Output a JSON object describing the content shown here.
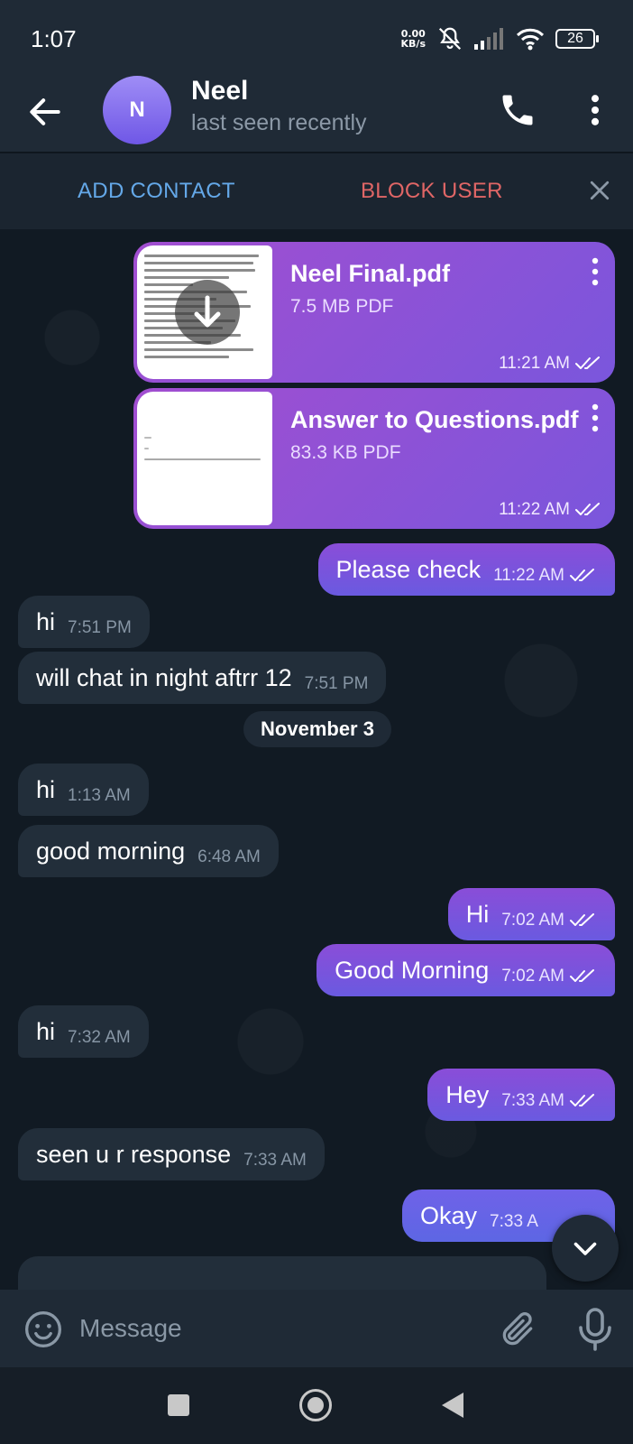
{
  "status_bar": {
    "time": "1:07",
    "net_speed_value": "0.00",
    "net_speed_unit": "KB/s",
    "battery": "26"
  },
  "header": {
    "avatar_letter": "N",
    "name": "Neel",
    "status": "last seen recently"
  },
  "action_bar": {
    "add_contact": "ADD CONTACT",
    "block_user": "BLOCK USER"
  },
  "files": [
    {
      "name": "Neel Final.pdf",
      "size": "7.5 MB PDF",
      "time": "11:21 AM"
    },
    {
      "name": "Answer to Questions.pdf",
      "size": "83.3 KB PDF",
      "time": "11:22 AM"
    }
  ],
  "messages": [
    {
      "text": "Please check",
      "time": "11:22 AM"
    },
    {
      "text": "hi",
      "time": "7:51 PM"
    },
    {
      "text": "will chat in night aftrr 12",
      "time": "7:51 PM"
    },
    {
      "text": "hi",
      "time": "1:13 AM"
    },
    {
      "text": "good morning",
      "time": "6:48 AM"
    },
    {
      "text": "Hi",
      "time": "7:02 AM"
    },
    {
      "text": "Good Morning",
      "time": "7:02 AM"
    },
    {
      "text": "hi",
      "time": "7:32 AM"
    },
    {
      "text": "Hey",
      "time": "7:33 AM"
    },
    {
      "text": "seen u r response",
      "time": "7:33 AM"
    },
    {
      "text": "Okay",
      "time": "7:33 A"
    }
  ],
  "date_separator": "November 3",
  "input": {
    "placeholder": "Message"
  },
  "colors": {
    "outgoing_bubble": "#7a56dc",
    "incoming_bubble": "#222e3a",
    "header_bg": "#1f2a36",
    "add_contact": "#64a8e8",
    "block_user": "#e06666"
  }
}
